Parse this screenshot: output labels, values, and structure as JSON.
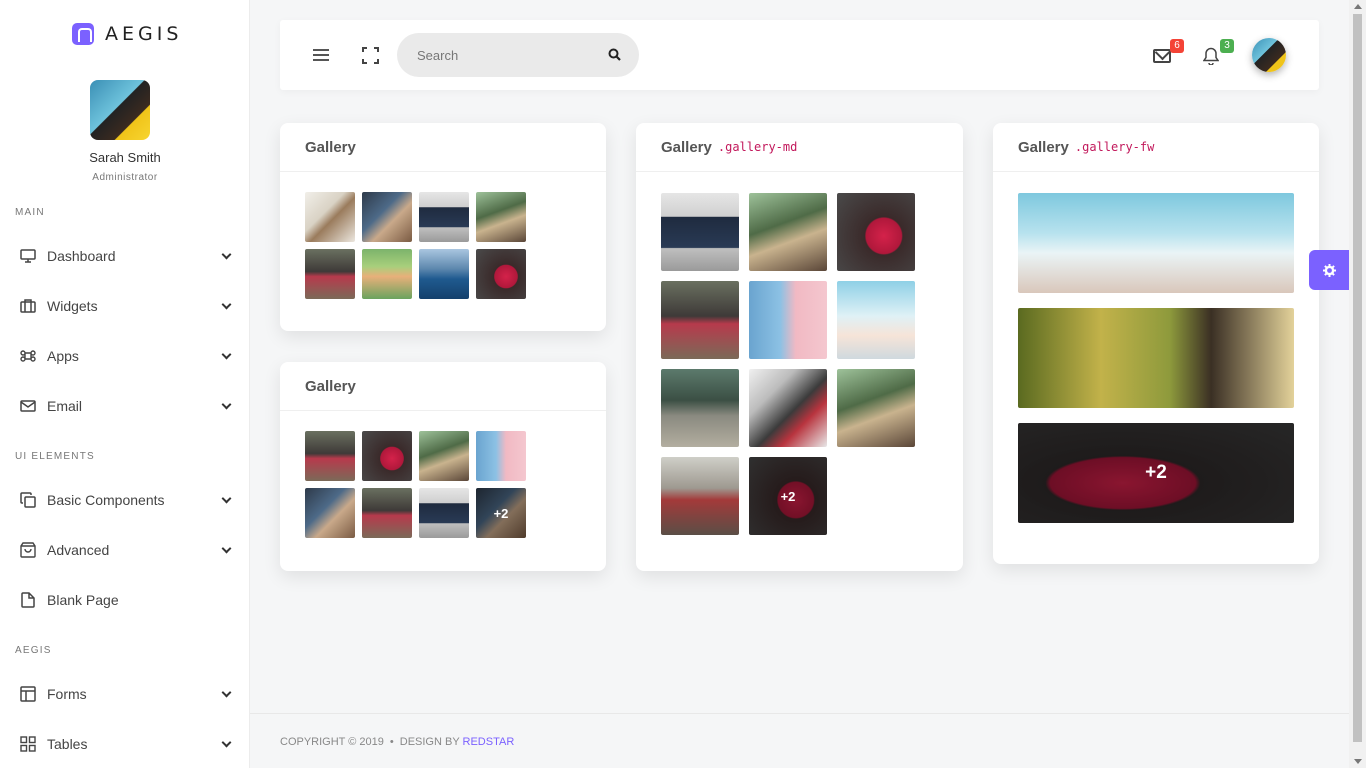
{
  "brand": {
    "name": "AEGIS"
  },
  "profile": {
    "name": "Sarah Smith",
    "role": "Administrator"
  },
  "sidebar": {
    "sections": [
      {
        "label": "MAIN"
      },
      {
        "label": "UI ELEMENTS"
      },
      {
        "label": "AEGIS"
      }
    ],
    "items": [
      {
        "label": "Dashboard",
        "icon": "monitor-icon",
        "has_submenu": true
      },
      {
        "label": "Widgets",
        "icon": "briefcase-icon",
        "has_submenu": true
      },
      {
        "label": "Apps",
        "icon": "command-icon",
        "has_submenu": true
      },
      {
        "label": "Email",
        "icon": "mail-icon",
        "has_submenu": true
      },
      {
        "label": "Basic Components",
        "icon": "copy-icon",
        "has_submenu": true
      },
      {
        "label": "Advanced",
        "icon": "shopping-bag-icon",
        "has_submenu": true
      },
      {
        "label": "Blank Page",
        "icon": "file-icon",
        "has_submenu": false
      },
      {
        "label": "Forms",
        "icon": "layout-icon",
        "has_submenu": true
      },
      {
        "label": "Tables",
        "icon": "grid-icon",
        "has_submenu": true
      }
    ]
  },
  "header": {
    "search": {
      "placeholder": "Search",
      "value": ""
    },
    "mail_badge": "6",
    "notification_badge": "3"
  },
  "cards": [
    {
      "title": "Gallery",
      "code": ""
    },
    {
      "title": "Gallery",
      "code": ""
    },
    {
      "title": "Gallery",
      "code": ".gallery-md"
    },
    {
      "title": "Gallery",
      "code": ".gallery-fw"
    }
  ],
  "gallery_more": {
    "card2": "+2",
    "card3": "+2",
    "card4": "+2"
  },
  "footer": {
    "copyright": "COPYRIGHT © 2019",
    "design_by": "DESIGN BY",
    "author": "REDSTAR"
  },
  "colors": {
    "accent": "#7b61ff",
    "mail_badge": "#f44336",
    "notification_badge": "#4caf50",
    "code": "#c2185b"
  }
}
